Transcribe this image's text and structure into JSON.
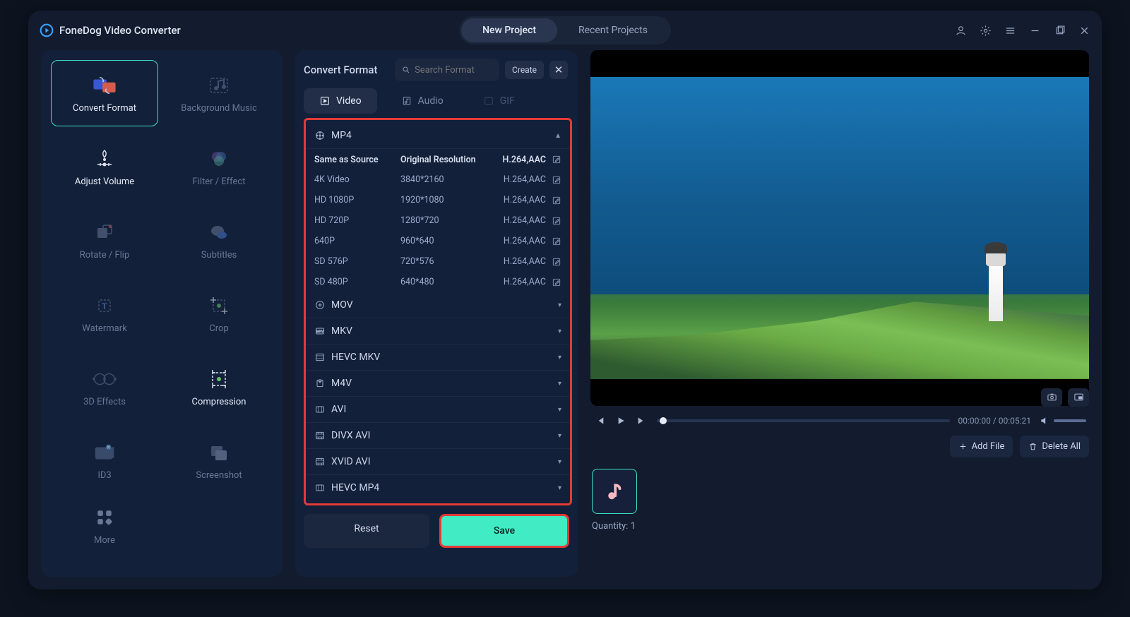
{
  "app": {
    "title": "FoneDog Video Converter"
  },
  "top_tabs": {
    "new_project": "New Project",
    "recent": "Recent Projects"
  },
  "sidebar": {
    "tools": [
      {
        "label": "Convert Format",
        "icon": "convert"
      },
      {
        "label": "Background Music",
        "icon": "music"
      },
      {
        "label": "Adjust Volume",
        "icon": "volume"
      },
      {
        "label": "Filter / Effect",
        "icon": "filter"
      },
      {
        "label": "Rotate / Flip",
        "icon": "rotate"
      },
      {
        "label": "Subtitles",
        "icon": "subtitles"
      },
      {
        "label": "Watermark",
        "icon": "watermark"
      },
      {
        "label": "Crop",
        "icon": "crop"
      },
      {
        "label": "3D Effects",
        "icon": "3d"
      },
      {
        "label": "Compression",
        "icon": "compress"
      },
      {
        "label": "ID3",
        "icon": "id3"
      },
      {
        "label": "Screenshot",
        "icon": "screenshot"
      }
    ],
    "more": "More"
  },
  "panel": {
    "title": "Convert Format",
    "search_placeholder": "Search Format",
    "create": "Create",
    "tabs": {
      "video": "Video",
      "audio": "Audio",
      "gif": "GIF"
    },
    "head_cols": {
      "name": "Same as Source",
      "res": "Original Resolution",
      "codec": "H.264,AAC"
    },
    "mp4": {
      "label": "MP4",
      "presets": [
        {
          "name": "4K Video",
          "res": "3840*2160",
          "codec": "H.264,AAC"
        },
        {
          "name": "HD 1080P",
          "res": "1920*1080",
          "codec": "H.264,AAC"
        },
        {
          "name": "HD 720P",
          "res": "1280*720",
          "codec": "H.264,AAC"
        },
        {
          "name": "640P",
          "res": "960*640",
          "codec": "H.264,AAC"
        },
        {
          "name": "SD 576P",
          "res": "720*576",
          "codec": "H.264,AAC"
        },
        {
          "name": "SD 480P",
          "res": "640*480",
          "codec": "H.264,AAC"
        }
      ]
    },
    "others": [
      "MOV",
      "MKV",
      "HEVC MKV",
      "M4V",
      "AVI",
      "DIVX AVI",
      "XVID AVI",
      "HEVC MP4"
    ],
    "reset": "Reset",
    "save": "Save"
  },
  "player": {
    "time_current": "00:00:00",
    "time_total": "00:05:21"
  },
  "files": {
    "add": "Add File",
    "delete": "Delete All",
    "quantity_label": "Quantity:",
    "quantity_value": "1"
  }
}
